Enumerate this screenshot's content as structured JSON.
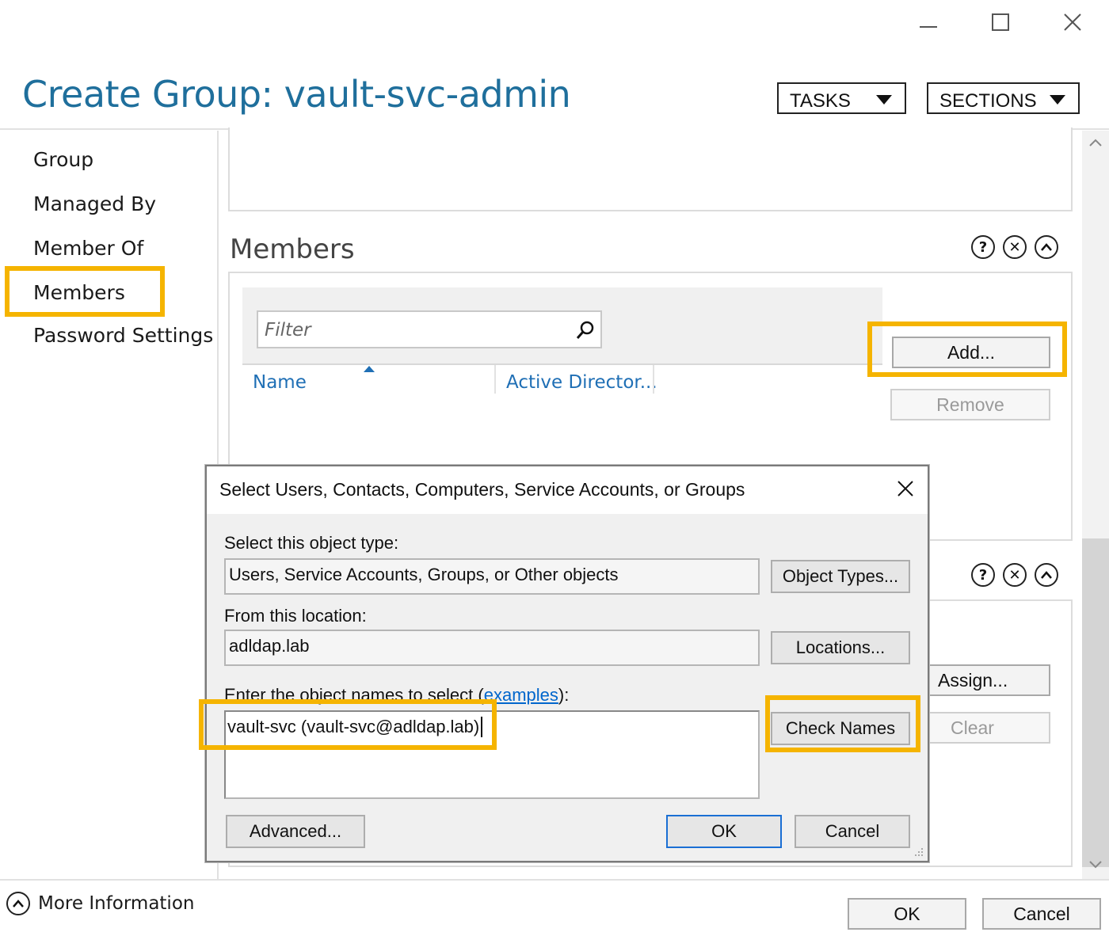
{
  "window": {
    "title": "Create Group: vault-svc-admin",
    "controls": {
      "minimize": "—",
      "maximize": "☐",
      "close": "✕"
    }
  },
  "header": {
    "tasks_label": "TASKS",
    "sections_label": "SECTIONS"
  },
  "nav": {
    "items": [
      {
        "label": "Group"
      },
      {
        "label": "Managed By"
      },
      {
        "label": "Member Of"
      },
      {
        "label": "Members",
        "selected": true
      },
      {
        "label": "Password Settings"
      }
    ]
  },
  "members": {
    "title": "Members",
    "filter_placeholder": "Filter",
    "columns": [
      "Name",
      "Active Director..."
    ],
    "add_label": "Add...",
    "remove_label": "Remove"
  },
  "password_settings": {
    "assign_label": "Assign...",
    "clear_label": "Clear"
  },
  "footer": {
    "more_info_label": "More Information",
    "ok_label": "OK",
    "cancel_label": "Cancel"
  },
  "dialog": {
    "title": "Select Users, Contacts, Computers, Service Accounts, or Groups",
    "object_type_label": "Select this object type:",
    "object_type_value": "Users, Service Accounts, Groups, or Other objects",
    "object_types_button": "Object Types...",
    "location_label": "From this location:",
    "location_value": "adldap.lab",
    "locations_button": "Locations...",
    "names_label_prefix": "Enter the object names to select (",
    "names_label_link": "examples",
    "names_label_suffix": "):",
    "names_value": "vault-svc (vault-svc@adldap.lab)",
    "check_names_button": "Check Names",
    "advanced_button": "Advanced...",
    "ok_button": "OK",
    "cancel_button": "Cancel"
  },
  "colors": {
    "title_blue": "#1f6f9c",
    "link_blue": "#1f6fb5",
    "highlight": "#f5b400",
    "ok_border": "#1a6fd4"
  }
}
